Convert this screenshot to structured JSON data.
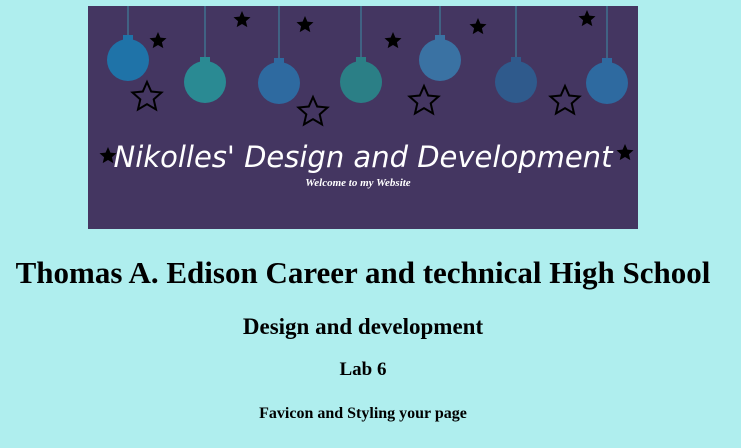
{
  "banner": {
    "title": "Nikolles' Design and Development",
    "subtitle": "Welcome to my Website",
    "background": "#443661",
    "ornament_colors": [
      "#1f73a8",
      "#2a8a93",
      "#2e6aa0",
      "#2b7f86",
      "#3a72a3",
      "#2f5a8c"
    ]
  },
  "headings": {
    "school": "Thomas A. Edison Career and technical High School",
    "course": "Design and development",
    "lab": "Lab 6",
    "topic": "Favicon and Styling your page"
  },
  "colors": {
    "page_background": "#afeeee",
    "text": "#000000"
  }
}
